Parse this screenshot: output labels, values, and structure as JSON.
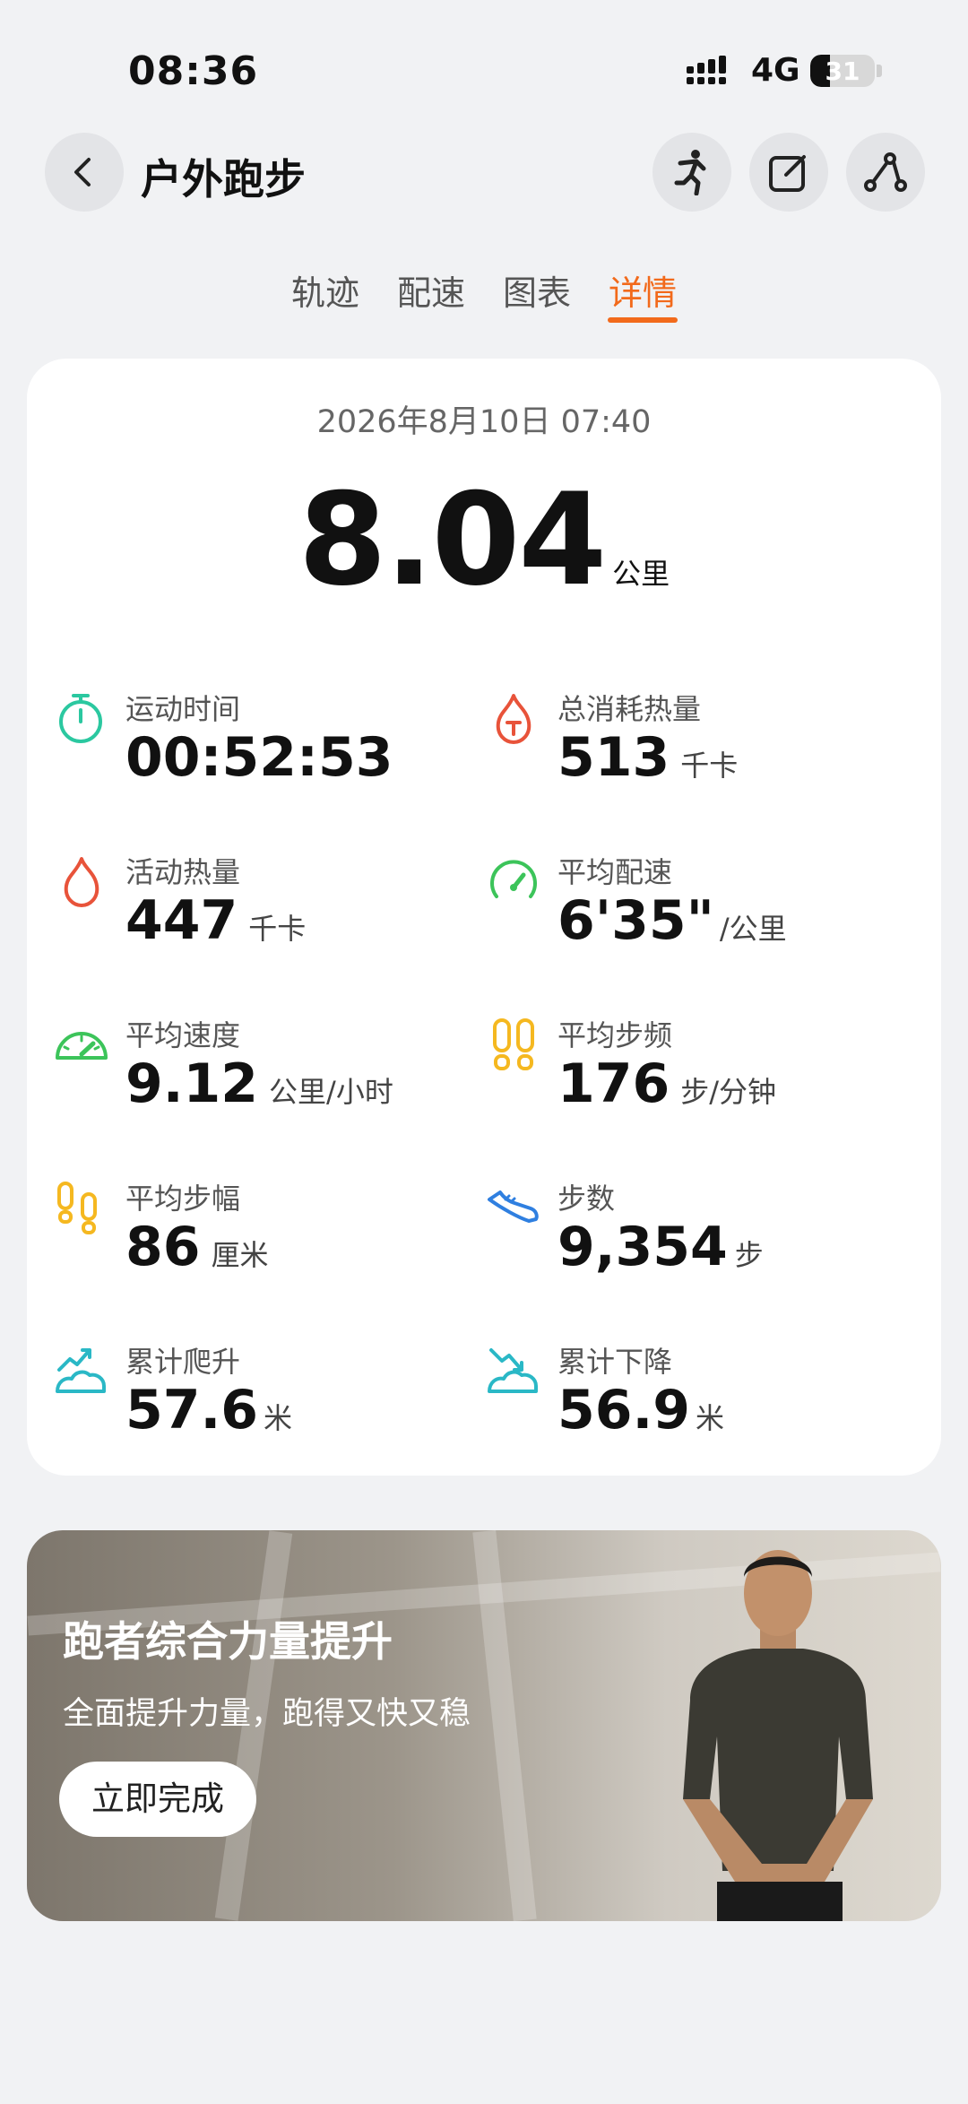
{
  "status_bar": {
    "time": "08:36",
    "network": "4G",
    "battery": "31",
    "battery_level": 0.31
  },
  "header": {
    "title": "户外跑步",
    "back_icon": "chevron-left-icon",
    "action_icons": [
      "runner-icon",
      "edit-icon",
      "route-share-icon"
    ]
  },
  "tabs": [
    {
      "label": "轨迹",
      "active": false
    },
    {
      "label": "配速",
      "active": false
    },
    {
      "label": "图表",
      "active": false
    },
    {
      "label": "详情",
      "active": true
    }
  ],
  "summary": {
    "date": "2026年8月10日 07:40",
    "distance": "8.04",
    "distance_unit": "公里"
  },
  "metrics": [
    {
      "label": "运动时间",
      "value": "00:52:53",
      "unit": "",
      "icon": "stopwatch-icon",
      "color": "#2bc8a0"
    },
    {
      "label": "总消耗热量",
      "value": "513",
      "unit": "千卡",
      "icon": "calorie-flame-t-icon",
      "color": "#e8533a"
    },
    {
      "label": "活动热量",
      "value": "447",
      "unit": "千卡",
      "icon": "flame-icon",
      "color": "#e8533a"
    },
    {
      "label": "平均配速",
      "value": "6'35\"",
      "unit": "/公里",
      "icon": "pace-gauge-icon",
      "color": "#3cc45a"
    },
    {
      "label": "平均速度",
      "value": "9.12",
      "unit": "公里/小时",
      "icon": "speedometer-icon",
      "color": "#3cc45a"
    },
    {
      "label": "平均步频",
      "value": "176",
      "unit": "步/分钟",
      "icon": "footprints-icon",
      "color": "#f5b820"
    },
    {
      "label": "平均步幅",
      "value": "86",
      "unit": "厘米",
      "icon": "stride-footprints-icon",
      "color": "#f5b820"
    },
    {
      "label": "步数",
      "value": "9,354",
      "unit": "步",
      "icon": "sneaker-icon",
      "color": "#2f7fe0"
    },
    {
      "label": "累计爬升",
      "value": "57.6",
      "unit": "米",
      "icon": "ascent-icon",
      "color": "#2ab8c6"
    },
    {
      "label": "累计下降",
      "value": "56.9",
      "unit": "米",
      "icon": "descent-icon",
      "color": "#2ab8c6"
    }
  ],
  "promo": {
    "title": "跑者综合力量提升",
    "subtitle": "全面提升力量，跑得又快又稳",
    "button_label": "立即完成"
  },
  "colors": {
    "accent": "#f26a1b",
    "background": "#f1f2f4",
    "card": "#ffffff"
  }
}
